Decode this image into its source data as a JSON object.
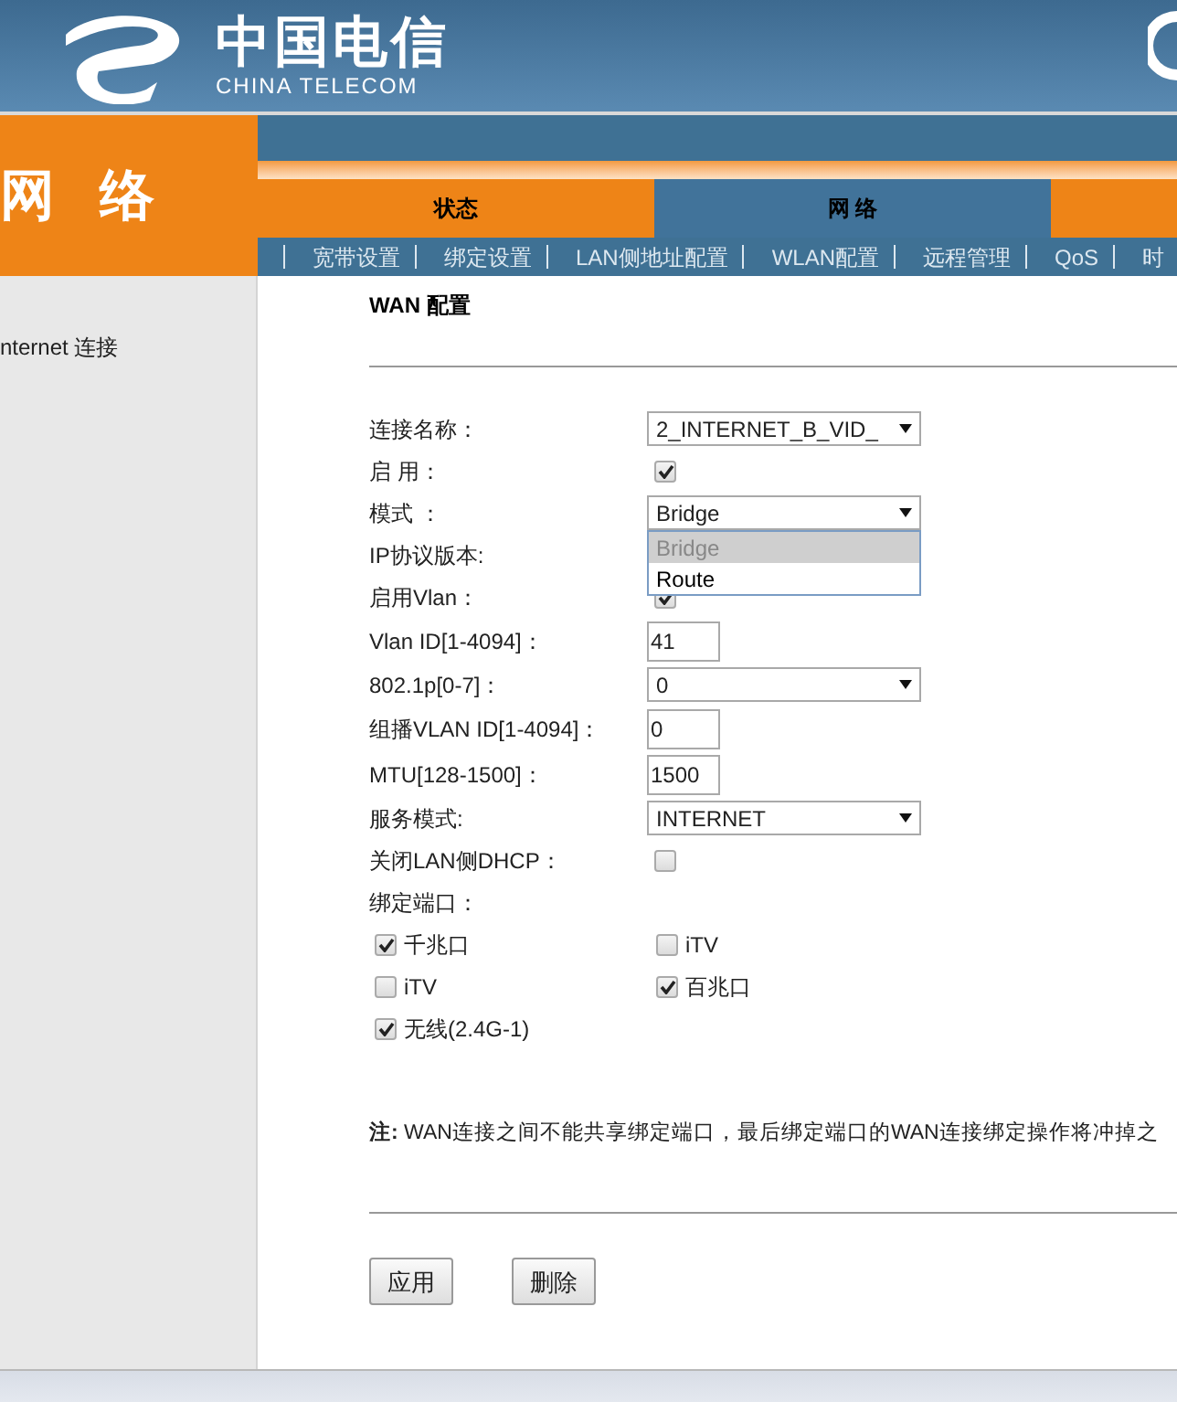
{
  "logo": {
    "chinese": "中国电信",
    "english": "CHINA TELECOM"
  },
  "section_title": "网 络",
  "top_tabs": [
    {
      "label": "状态",
      "selected": false
    },
    {
      "label": "网 络",
      "selected": true
    }
  ],
  "sub_nav": [
    "宽带设置",
    "绑定设置",
    "LAN侧地址配置",
    "WLAN配置",
    "远程管理",
    "QoS",
    "时"
  ],
  "sidebar": {
    "items": [
      "nternet 连接"
    ]
  },
  "page_title": "WAN 配置",
  "fields": [
    {
      "kind": "select",
      "label": "连接名称：",
      "value": "2_INTERNET_B_VID_"
    },
    {
      "kind": "checkbox",
      "label": "启 用：",
      "checked": true
    },
    {
      "kind": "select",
      "label": "模式 ：",
      "value": "Bridge",
      "expanded": true,
      "options": [
        {
          "label": "Bridge",
          "selected": true
        },
        {
          "label": "Route",
          "selected": false
        }
      ]
    },
    {
      "kind": "label",
      "label": "IP协议版本:"
    },
    {
      "kind": "checkbox",
      "label": "启用Vlan：",
      "checked": true
    },
    {
      "kind": "text",
      "label": "Vlan ID[1-4094]：",
      "value": "41"
    },
    {
      "kind": "select",
      "label": "802.1p[0-7]：",
      "value": "0"
    },
    {
      "kind": "text",
      "label": "组播VLAN ID[1-4094]：",
      "value": "0"
    },
    {
      "kind": "text",
      "label": "MTU[128-1500]：",
      "value": "1500"
    },
    {
      "kind": "select",
      "label": "服务模式:",
      "value": "INTERNET"
    },
    {
      "kind": "checkbox",
      "label": "关闭LAN侧DHCP：",
      "checked": false
    },
    {
      "kind": "label",
      "label": "绑定端口："
    }
  ],
  "ports": [
    {
      "label": "千兆口",
      "checked": true
    },
    {
      "label": "iTV",
      "checked": false
    },
    {
      "label": "iTV",
      "checked": false
    },
    {
      "label": "百兆口",
      "checked": true
    },
    {
      "label": "无线(2.4G-1)",
      "checked": true
    }
  ],
  "note": "**注:** WAN连接之间不能共享绑定端口，最后绑定端口的WAN连接绑定操作将冲掉之",
  "buttons": [
    "应用",
    "删除"
  ]
}
